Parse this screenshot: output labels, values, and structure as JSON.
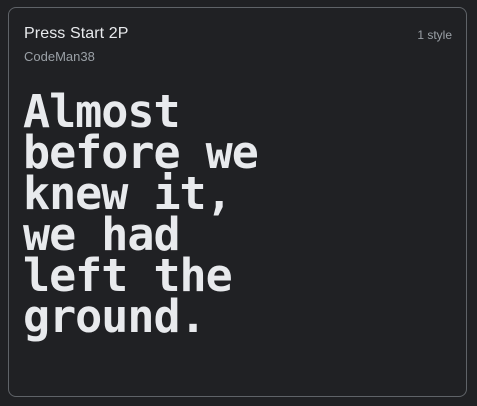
{
  "card": {
    "font_name": "Press Start 2P",
    "style_count": "1 style",
    "designer": "CodeMan38",
    "preview_lines": [
      "Almost",
      "before we",
      "knew it,",
      "we had",
      "left the",
      "ground."
    ]
  },
  "colors": {
    "background": "#202124",
    "border": "#5f6368",
    "primary_text": "#e8eaed",
    "secondary_text": "#9aa0a6"
  }
}
